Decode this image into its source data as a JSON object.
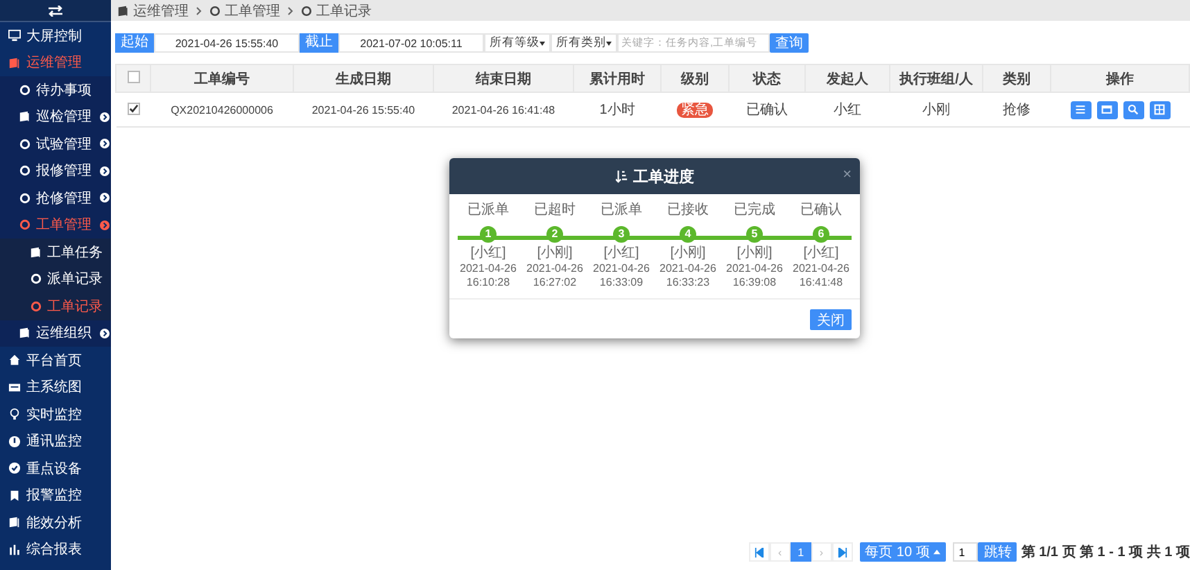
{
  "sidebar": {
    "items": [
      {
        "label": "大屏控制",
        "kind": "monitor",
        "active": false
      },
      {
        "label": "运维管理",
        "kind": "book",
        "active": true,
        "children": [
          {
            "label": "待办事项",
            "kind": "circle",
            "active": false,
            "expandable": false
          },
          {
            "label": "巡检管理",
            "kind": "book",
            "active": false,
            "expandable": true
          },
          {
            "label": "试验管理",
            "kind": "circle",
            "active": false,
            "expandable": true
          },
          {
            "label": "报修管理",
            "kind": "circle",
            "active": false,
            "expandable": true
          },
          {
            "label": "抢修管理",
            "kind": "circle",
            "active": false,
            "expandable": true
          },
          {
            "label": "工单管理",
            "kind": "circle",
            "active": true,
            "expandable": true,
            "children": [
              {
                "label": "工单任务",
                "kind": "book",
                "active": false
              },
              {
                "label": "派单记录",
                "kind": "circle",
                "active": false
              },
              {
                "label": "工单记录",
                "kind": "circle",
                "active": true
              }
            ]
          },
          {
            "label": "运维组织",
            "kind": "book",
            "active": false,
            "expandable": true
          }
        ]
      },
      {
        "label": "平台首页",
        "kind": "home",
        "active": false
      },
      {
        "label": "主系统图",
        "kind": "card",
        "active": false
      },
      {
        "label": "实时监控",
        "kind": "bulb",
        "active": false
      },
      {
        "label": "通讯监控",
        "kind": "info",
        "active": false
      },
      {
        "label": "重点设备",
        "kind": "check",
        "active": false
      },
      {
        "label": "报警监控",
        "kind": "bookmark",
        "active": false
      },
      {
        "label": "能效分析",
        "kind": "book",
        "active": false
      },
      {
        "label": "综合报表",
        "kind": "chart",
        "active": false
      }
    ]
  },
  "breadcrumb": [
    "运维管理",
    "工单管理",
    "工单记录"
  ],
  "filters": {
    "start_label": "起始",
    "start_value": "2021-04-26 15:55:40",
    "end_label": "截止",
    "end_value": "2021-07-02 10:05:11",
    "level_select": "所有等级",
    "type_select": "所有类别",
    "search_placeholder": "关键字：任务内容,工单编号",
    "search_button": "查询"
  },
  "table": {
    "header_checked": false,
    "columns": [
      "工单编号",
      "生成日期",
      "结束日期",
      "累计用时",
      "级别",
      "状态",
      "发起人",
      "执行班组/人",
      "类别",
      "操作"
    ],
    "rows": [
      {
        "checked": true,
        "id": "QX20210426000006",
        "created": "2021-04-26 15:55:40",
        "ended": "2021-04-26 16:41:48",
        "duration": "1小时",
        "level": "紧急",
        "status": "已确认",
        "initiator": "小红",
        "executor": "小刚",
        "category": "抢修",
        "actions": [
          {
            "kind": "list"
          },
          {
            "kind": "window"
          },
          {
            "kind": "search"
          },
          {
            "kind": "grid"
          }
        ]
      }
    ]
  },
  "modal": {
    "title": "工单进度",
    "close": "×",
    "button": "关闭",
    "steps": [
      {
        "number": "1",
        "status": "已派单",
        "person": "[小红]",
        "date": "2021-04-26",
        "time": "16:10:28",
        "done": true
      },
      {
        "number": "2",
        "status": "已超时",
        "person": "[小刚]",
        "date": "2021-04-26",
        "time": "16:27:02",
        "done": true
      },
      {
        "number": "3",
        "status": "已派单",
        "person": "[小红]",
        "date": "2021-04-26",
        "time": "16:33:09",
        "done": true
      },
      {
        "number": "4",
        "status": "已接收",
        "person": "[小刚]",
        "date": "2021-04-26",
        "time": "16:33:23",
        "done": true
      },
      {
        "number": "5",
        "status": "已完成",
        "person": "[小刚]",
        "date": "2021-04-26",
        "time": "16:39:08",
        "done": true
      },
      {
        "number": "6",
        "status": "已确认",
        "person": "[小红]",
        "date": "2021-04-26",
        "time": "16:41:48",
        "done": true
      }
    ]
  },
  "pagination": {
    "pages": [
      {
        "label": "1",
        "selected": true
      }
    ],
    "prev": "‹",
    "next": "›",
    "page_size": "每页 10 项",
    "goto_value": "1",
    "goto_button": "跳转",
    "info": "第 1/1 页  第 1 - 1 项  共 1 项"
  }
}
